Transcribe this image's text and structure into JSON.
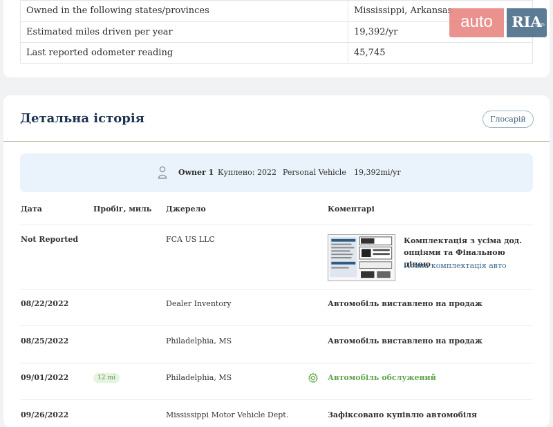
{
  "summary_rows": [
    {
      "label": "Owned in the following states/provinces",
      "value": "Mississippi, Arkansas"
    },
    {
      "label": "Estimated miles driven per year",
      "value": "19,392/yr"
    },
    {
      "label": "Last reported odometer reading",
      "value": "45,745"
    }
  ],
  "logo": {
    "auto": "auto",
    "ria": "RIA",
    "com": ".com"
  },
  "section": {
    "title": "Детальна історія",
    "glossary_label": "Глосарій"
  },
  "owner": {
    "name": "Owner 1",
    "bought": "Куплено: 2022",
    "type": "Personal Vehicle",
    "miles": "19,392mi/yr"
  },
  "columns": {
    "date": "Дата",
    "mileage": "Пробіг, миль",
    "source": "Джерело",
    "comments": "Коментарі"
  },
  "rows": [
    {
      "date": "Not Reported",
      "mileage": "",
      "source": "FCA US LLC",
      "comment": "Комплектація з усіма дод. опціями та Фінальною ціною",
      "link": "Повна комплектація авто"
    },
    {
      "date": "08/22/2022",
      "mileage": "",
      "source": "Dealer Inventory",
      "comment": "Автомобіль виставлено на продаж"
    },
    {
      "date": "08/25/2022",
      "mileage": "",
      "source": "Philadelphia, MS",
      "comment": "Автомобіль виставлено на продаж"
    },
    {
      "date": "09/01/2022",
      "mileage": "12 mi",
      "source": "Philadelphia, MS",
      "comment": "Автомобіль обслужений"
    },
    {
      "date": "09/26/2022",
      "mileage": "",
      "source": "Mississippi Motor Vehicle Dept.",
      "comment": "Зафіксовано купівлю автомобіля"
    }
  ],
  "colors": {
    "title": "#1d3450",
    "accent_green": "#5ea64b",
    "owner_bg": "#eaf3fb"
  }
}
